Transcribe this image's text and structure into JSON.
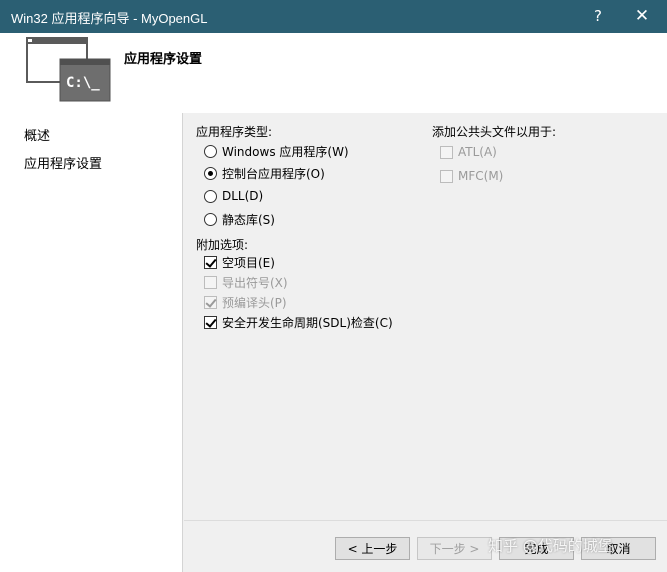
{
  "window": {
    "title": "Win32 应用程序向导 - MyOpenGL",
    "help_glyph": "?",
    "close_glyph": "✕"
  },
  "header": {
    "heading": "应用程序设置",
    "logo_icon": "console-window-icon",
    "logo_text": "C:\\_"
  },
  "sidebar": {
    "items": [
      {
        "label": "概述"
      },
      {
        "label": "应用程序设置"
      }
    ]
  },
  "app_type": {
    "label": "应用程序类型:",
    "options": [
      {
        "label": "Windows 应用程序(W)",
        "selected": false
      },
      {
        "label": "控制台应用程序(O)",
        "selected": true
      },
      {
        "label": "DLL(D)",
        "selected": false
      },
      {
        "label": "静态库(S)",
        "selected": false
      }
    ]
  },
  "extra_options": {
    "label": "附加选项:",
    "options": [
      {
        "label": "空项目(E)",
        "checked": true,
        "enabled": true
      },
      {
        "label": "导出符号(X)",
        "checked": false,
        "enabled": false
      },
      {
        "label": "预编译头(P)",
        "checked": true,
        "enabled": false
      },
      {
        "label": "安全开发生命周期(SDL)检查(C)",
        "checked": true,
        "enabled": true
      }
    ]
  },
  "common_headers": {
    "label": "添加公共头文件以用于:",
    "options": [
      {
        "label": "ATL(A)",
        "checked": false,
        "enabled": false
      },
      {
        "label": "MFC(M)",
        "checked": false,
        "enabled": false
      }
    ]
  },
  "buttons": {
    "prev": "< 上一步",
    "next": "下一步 >",
    "finish": "完成",
    "cancel": "取消"
  },
  "watermark": "知乎 @代码的城堡",
  "colors": {
    "titlebar": "#2b5f73",
    "panel": "#f0f0f0"
  }
}
